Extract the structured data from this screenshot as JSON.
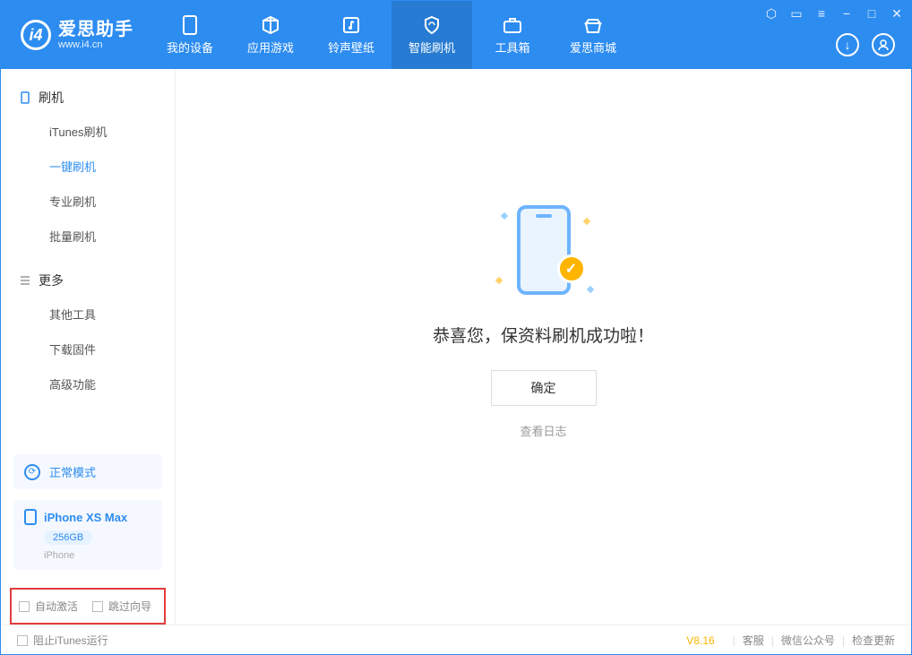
{
  "brand": {
    "name": "爱思助手",
    "url": "www.i4.cn",
    "logo_letter": "i4"
  },
  "tabs": [
    {
      "label": "我的设备"
    },
    {
      "label": "应用游戏"
    },
    {
      "label": "铃声壁纸"
    },
    {
      "label": "智能刷机"
    },
    {
      "label": "工具箱"
    },
    {
      "label": "爱思商城"
    }
  ],
  "sidebar": {
    "sections": [
      {
        "title": "刷机",
        "items": [
          "iTunes刷机",
          "一键刷机",
          "专业刷机",
          "批量刷机"
        ]
      },
      {
        "title": "更多",
        "items": [
          "其他工具",
          "下载固件",
          "高级功能"
        ]
      }
    ]
  },
  "device": {
    "mode": "正常模式",
    "name": "iPhone XS Max",
    "capacity": "256GB",
    "type": "iPhone"
  },
  "checkboxes": {
    "auto_activate": "自动激活",
    "skip_guide": "跳过向导"
  },
  "main": {
    "success_text": "恭喜您，保资料刷机成功啦！",
    "ok": "确定",
    "view_log": "查看日志"
  },
  "statusbar": {
    "block_itunes": "阻止iTunes运行",
    "version": "V8.16",
    "links": [
      "客服",
      "微信公众号",
      "检查更新"
    ]
  }
}
